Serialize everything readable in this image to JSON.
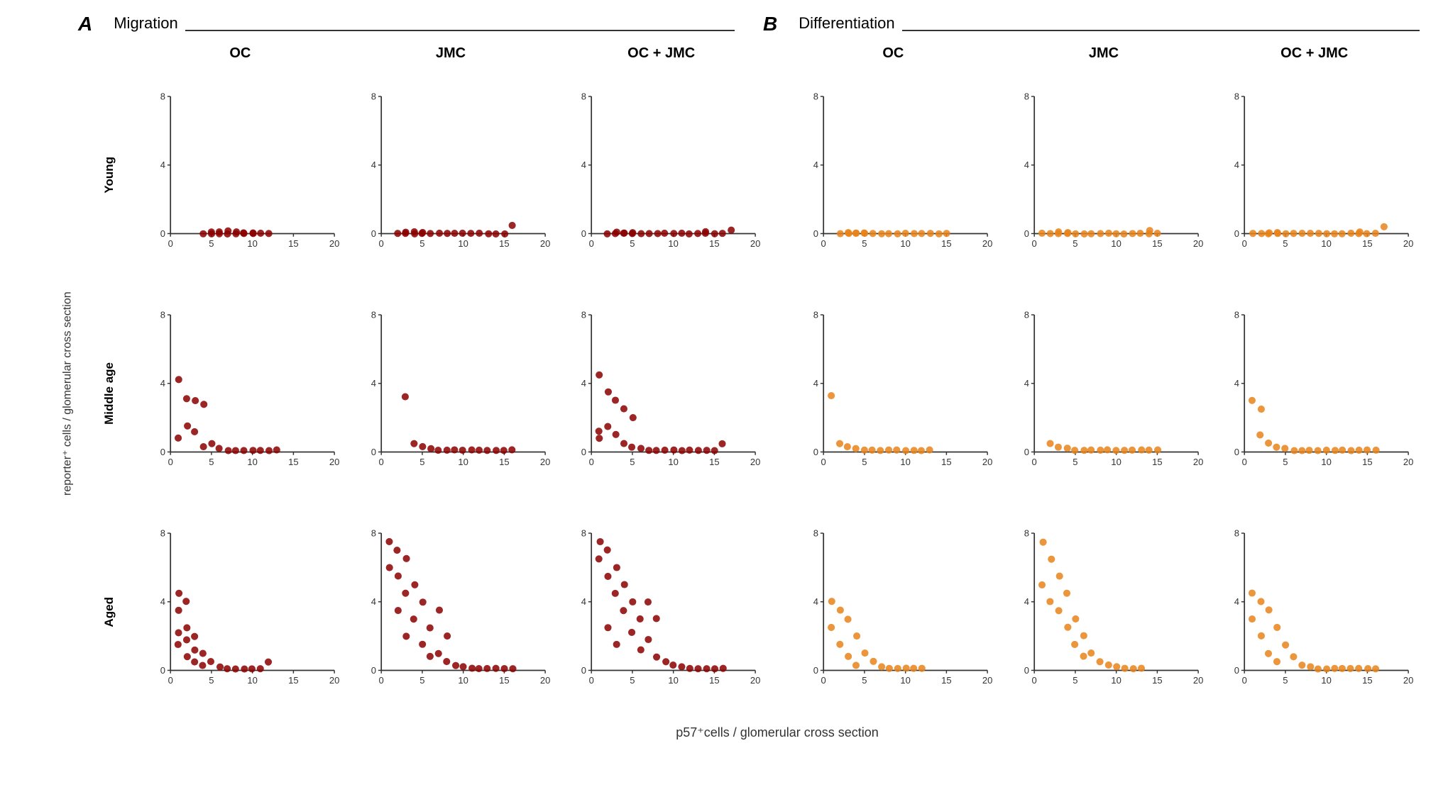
{
  "sections": [
    {
      "letter": "A",
      "title": "Migration"
    },
    {
      "letter": "B",
      "title": "Differentiation"
    }
  ],
  "column_headers": [
    "OC",
    "JMC",
    "OC + JMC",
    "OC",
    "JMC",
    "OC + JMC"
  ],
  "row_labels": [
    "Young",
    "Middle age",
    "Aged"
  ],
  "y_axis_label": "reporter⁺ cells / glomerular cross section",
  "x_axis_label": "p57⁺cells / glomerular cross section",
  "migration_color": "#8B0000",
  "differentiation_color": "#E8821A",
  "charts": {
    "migration": {
      "young": {
        "OC": [
          [
            4,
            0
          ],
          [
            5,
            0
          ],
          [
            6,
            0
          ],
          [
            7,
            0
          ],
          [
            8,
            0
          ],
          [
            9,
            0
          ],
          [
            10,
            0
          ],
          [
            11,
            0
          ],
          [
            12,
            0
          ],
          [
            5,
            0.1
          ],
          [
            6,
            0.1
          ],
          [
            7,
            0.15
          ],
          [
            8,
            0.1
          ],
          [
            9,
            0.05
          ],
          [
            10,
            0.05
          ]
        ],
        "JMC": [
          [
            2,
            0
          ],
          [
            3,
            0
          ],
          [
            4,
            0
          ],
          [
            5,
            0
          ],
          [
            6,
            0
          ],
          [
            7,
            0
          ],
          [
            8,
            0
          ],
          [
            9,
            0
          ],
          [
            10,
            0
          ],
          [
            11,
            0
          ],
          [
            12,
            0
          ],
          [
            13,
            0
          ],
          [
            14,
            0
          ],
          [
            15,
            0
          ],
          [
            16,
            0.5
          ],
          [
            3,
            0.1
          ],
          [
            4,
            0.1
          ],
          [
            5,
            0.05
          ]
        ],
        "OC+JMC": [
          [
            2,
            0
          ],
          [
            3,
            0
          ],
          [
            4,
            0
          ],
          [
            5,
            0
          ],
          [
            6,
            0
          ],
          [
            7,
            0
          ],
          [
            8,
            0
          ],
          [
            9,
            0
          ],
          [
            10,
            0
          ],
          [
            11,
            0
          ],
          [
            12,
            0
          ],
          [
            13,
            0
          ],
          [
            14,
            0
          ],
          [
            15,
            0
          ],
          [
            16,
            0
          ],
          [
            17,
            0.2
          ],
          [
            3,
            0.1
          ],
          [
            4,
            0.05
          ],
          [
            5,
            0.05
          ],
          [
            14,
            0.1
          ]
        ]
      },
      "middle": {
        "OC": [
          [
            1,
            4.2
          ],
          [
            2,
            3.1
          ],
          [
            3,
            3.0
          ],
          [
            4,
            2.8
          ],
          [
            2,
            1.5
          ],
          [
            3,
            1.2
          ],
          [
            1,
            0.8
          ],
          [
            5,
            0.5
          ],
          [
            4,
            0.3
          ],
          [
            6,
            0.2
          ],
          [
            7,
            0.1
          ],
          [
            8,
            0.1
          ],
          [
            9,
            0.1
          ],
          [
            10,
            0.1
          ],
          [
            11,
            0.1
          ],
          [
            12,
            0.1
          ],
          [
            13,
            0.1
          ]
        ],
        "JMC": [
          [
            3,
            3.2
          ],
          [
            4,
            0.5
          ],
          [
            5,
            0.3
          ],
          [
            6,
            0.2
          ],
          [
            7,
            0.1
          ],
          [
            8,
            0.1
          ],
          [
            9,
            0.1
          ],
          [
            10,
            0.1
          ],
          [
            11,
            0.1
          ],
          [
            12,
            0.1
          ],
          [
            13,
            0.1
          ],
          [
            14,
            0.1
          ],
          [
            15,
            0.1
          ],
          [
            16,
            0.1
          ]
        ],
        "OC+JMC": [
          [
            1,
            4.5
          ],
          [
            2,
            3.5
          ],
          [
            3,
            3.0
          ],
          [
            4,
            2.5
          ],
          [
            5,
            2.0
          ],
          [
            2,
            1.5
          ],
          [
            3,
            1.0
          ],
          [
            1,
            0.8
          ],
          [
            4,
            0.5
          ],
          [
            5,
            0.3
          ],
          [
            6,
            0.2
          ],
          [
            7,
            0.1
          ],
          [
            8,
            0.1
          ],
          [
            9,
            0.1
          ],
          [
            10,
            0.1
          ],
          [
            11,
            0.1
          ],
          [
            12,
            0.1
          ],
          [
            13,
            0.1
          ],
          [
            14,
            0.1
          ],
          [
            15,
            0.1
          ],
          [
            16,
            0.5
          ],
          [
            1,
            1.2
          ]
        ]
      },
      "aged": {
        "OC": [
          [
            1,
            4.5
          ],
          [
            2,
            4.0
          ],
          [
            1,
            3.5
          ],
          [
            2,
            2.5
          ],
          [
            3,
            2.0
          ],
          [
            1,
            2.2
          ],
          [
            2,
            1.8
          ],
          [
            1,
            1.5
          ],
          [
            3,
            1.2
          ],
          [
            4,
            1.0
          ],
          [
            2,
            0.8
          ],
          [
            5,
            0.5
          ],
          [
            3,
            0.5
          ],
          [
            4,
            0.3
          ],
          [
            6,
            0.2
          ],
          [
            7,
            0.1
          ],
          [
            8,
            0.1
          ],
          [
            9,
            0.1
          ],
          [
            10,
            0.1
          ],
          [
            11,
            0.1
          ],
          [
            12,
            0.5
          ]
        ],
        "JMC": [
          [
            1,
            7.5
          ],
          [
            2,
            7.0
          ],
          [
            3,
            6.5
          ],
          [
            1,
            6.0
          ],
          [
            2,
            5.5
          ],
          [
            4,
            5.0
          ],
          [
            3,
            4.5
          ],
          [
            5,
            4.0
          ],
          [
            2,
            3.5
          ],
          [
            4,
            3.0
          ],
          [
            6,
            2.5
          ],
          [
            3,
            2.0
          ],
          [
            5,
            1.5
          ],
          [
            7,
            1.0
          ],
          [
            6,
            0.8
          ],
          [
            8,
            0.5
          ],
          [
            9,
            0.3
          ],
          [
            10,
            0.2
          ],
          [
            11,
            0.1
          ],
          [
            12,
            0.1
          ],
          [
            13,
            0.1
          ],
          [
            14,
            0.1
          ],
          [
            15,
            0.1
          ],
          [
            16,
            0.1
          ],
          [
            7,
            3.5
          ],
          [
            8,
            2.0
          ]
        ],
        "OC+JMC": [
          [
            1,
            7.5
          ],
          [
            2,
            7.0
          ],
          [
            1,
            6.5
          ],
          [
            3,
            6.0
          ],
          [
            2,
            5.5
          ],
          [
            4,
            5.0
          ],
          [
            3,
            4.5
          ],
          [
            5,
            4.0
          ],
          [
            4,
            3.5
          ],
          [
            6,
            3.0
          ],
          [
            2,
            2.5
          ],
          [
            5,
            2.2
          ],
          [
            7,
            1.8
          ],
          [
            3,
            1.5
          ],
          [
            6,
            1.2
          ],
          [
            8,
            0.8
          ],
          [
            9,
            0.5
          ],
          [
            10,
            0.3
          ],
          [
            11,
            0.2
          ],
          [
            12,
            0.1
          ],
          [
            13,
            0.1
          ],
          [
            14,
            0.1
          ],
          [
            15,
            0.1
          ],
          [
            16,
            0.1
          ],
          [
            7,
            4.0
          ],
          [
            8,
            3.0
          ]
        ]
      }
    },
    "differentiation": {
      "young": {
        "OC": [
          [
            2,
            0
          ],
          [
            3,
            0
          ],
          [
            4,
            0
          ],
          [
            5,
            0
          ],
          [
            6,
            0
          ],
          [
            7,
            0
          ],
          [
            8,
            0
          ],
          [
            9,
            0
          ],
          [
            10,
            0
          ],
          [
            11,
            0
          ],
          [
            12,
            0
          ],
          [
            13,
            0
          ],
          [
            14,
            0
          ],
          [
            15,
            0
          ],
          [
            3,
            0.05
          ],
          [
            4,
            0.05
          ],
          [
            5,
            0.05
          ]
        ],
        "JMC": [
          [
            1,
            0
          ],
          [
            2,
            0
          ],
          [
            3,
            0
          ],
          [
            4,
            0
          ],
          [
            5,
            0
          ],
          [
            6,
            0
          ],
          [
            7,
            0
          ],
          [
            8,
            0
          ],
          [
            9,
            0
          ],
          [
            10,
            0
          ],
          [
            11,
            0
          ],
          [
            12,
            0
          ],
          [
            13,
            0
          ],
          [
            14,
            0
          ],
          [
            15,
            0
          ],
          [
            3,
            0.1
          ],
          [
            4,
            0.05
          ],
          [
            14,
            0.2
          ]
        ],
        "OC+JMC": [
          [
            1,
            0
          ],
          [
            2,
            0
          ],
          [
            3,
            0
          ],
          [
            4,
            0
          ],
          [
            5,
            0
          ],
          [
            6,
            0
          ],
          [
            7,
            0
          ],
          [
            8,
            0
          ],
          [
            9,
            0
          ],
          [
            10,
            0
          ],
          [
            11,
            0
          ],
          [
            12,
            0
          ],
          [
            13,
            0
          ],
          [
            14,
            0
          ],
          [
            15,
            0
          ],
          [
            16,
            0
          ],
          [
            17,
            0.4
          ],
          [
            3,
            0.05
          ],
          [
            4,
            0.05
          ],
          [
            14,
            0.1
          ]
        ]
      },
      "middle": {
        "OC": [
          [
            1,
            3.3
          ],
          [
            2,
            0.5
          ],
          [
            3,
            0.3
          ],
          [
            4,
            0.2
          ],
          [
            5,
            0.1
          ],
          [
            6,
            0.1
          ],
          [
            7,
            0.1
          ],
          [
            8,
            0.1
          ],
          [
            9,
            0.1
          ],
          [
            10,
            0.1
          ],
          [
            11,
            0.1
          ],
          [
            12,
            0.1
          ],
          [
            13,
            0.1
          ]
        ],
        "JMC": [
          [
            2,
            0.5
          ],
          [
            3,
            0.3
          ],
          [
            4,
            0.2
          ],
          [
            5,
            0.1
          ],
          [
            6,
            0.1
          ],
          [
            7,
            0.1
          ],
          [
            8,
            0.1
          ],
          [
            9,
            0.1
          ],
          [
            10,
            0.1
          ],
          [
            11,
            0.1
          ],
          [
            12,
            0.1
          ],
          [
            13,
            0.1
          ],
          [
            14,
            0.1
          ],
          [
            15,
            0.1
          ]
        ],
        "OC+JMC": [
          [
            1,
            3.0
          ],
          [
            2,
            2.5
          ],
          [
            3,
            0.5
          ],
          [
            4,
            0.3
          ],
          [
            5,
            0.2
          ],
          [
            6,
            0.1
          ],
          [
            7,
            0.1
          ],
          [
            8,
            0.1
          ],
          [
            9,
            0.1
          ],
          [
            10,
            0.1
          ],
          [
            11,
            0.1
          ],
          [
            12,
            0.1
          ],
          [
            13,
            0.1
          ],
          [
            14,
            0.1
          ],
          [
            15,
            0.1
          ],
          [
            16,
            0.1
          ],
          [
            2,
            1.0
          ]
        ]
      },
      "aged": {
        "OC": [
          [
            1,
            4.0
          ],
          [
            2,
            3.5
          ],
          [
            3,
            3.0
          ],
          [
            1,
            2.5
          ],
          [
            4,
            2.0
          ],
          [
            2,
            1.5
          ],
          [
            5,
            1.0
          ],
          [
            3,
            0.8
          ],
          [
            6,
            0.5
          ],
          [
            4,
            0.3
          ],
          [
            7,
            0.2
          ],
          [
            8,
            0.1
          ],
          [
            9,
            0.1
          ],
          [
            10,
            0.1
          ],
          [
            11,
            0.1
          ],
          [
            12,
            0.1
          ]
        ],
        "JMC": [
          [
            1,
            7.5
          ],
          [
            2,
            6.5
          ],
          [
            3,
            5.5
          ],
          [
            1,
            5.0
          ],
          [
            4,
            4.5
          ],
          [
            2,
            4.0
          ],
          [
            3,
            3.5
          ],
          [
            5,
            3.0
          ],
          [
            4,
            2.5
          ],
          [
            6,
            2.0
          ],
          [
            5,
            1.5
          ],
          [
            7,
            1.0
          ],
          [
            6,
            0.8
          ],
          [
            8,
            0.5
          ],
          [
            9,
            0.3
          ],
          [
            10,
            0.2
          ],
          [
            11,
            0.1
          ],
          [
            12,
            0.1
          ],
          [
            13,
            0.1
          ]
        ],
        "OC+JMC": [
          [
            1,
            4.5
          ],
          [
            2,
            4.0
          ],
          [
            3,
            3.5
          ],
          [
            1,
            3.0
          ],
          [
            4,
            2.5
          ],
          [
            2,
            2.0
          ],
          [
            5,
            1.5
          ],
          [
            3,
            1.0
          ],
          [
            6,
            0.8
          ],
          [
            4,
            0.5
          ],
          [
            7,
            0.3
          ],
          [
            8,
            0.2
          ],
          [
            9,
            0.1
          ],
          [
            10,
            0.1
          ],
          [
            11,
            0.1
          ],
          [
            12,
            0.1
          ],
          [
            13,
            0.1
          ],
          [
            14,
            0.1
          ],
          [
            15,
            0.1
          ],
          [
            16,
            0.1
          ]
        ]
      }
    }
  }
}
